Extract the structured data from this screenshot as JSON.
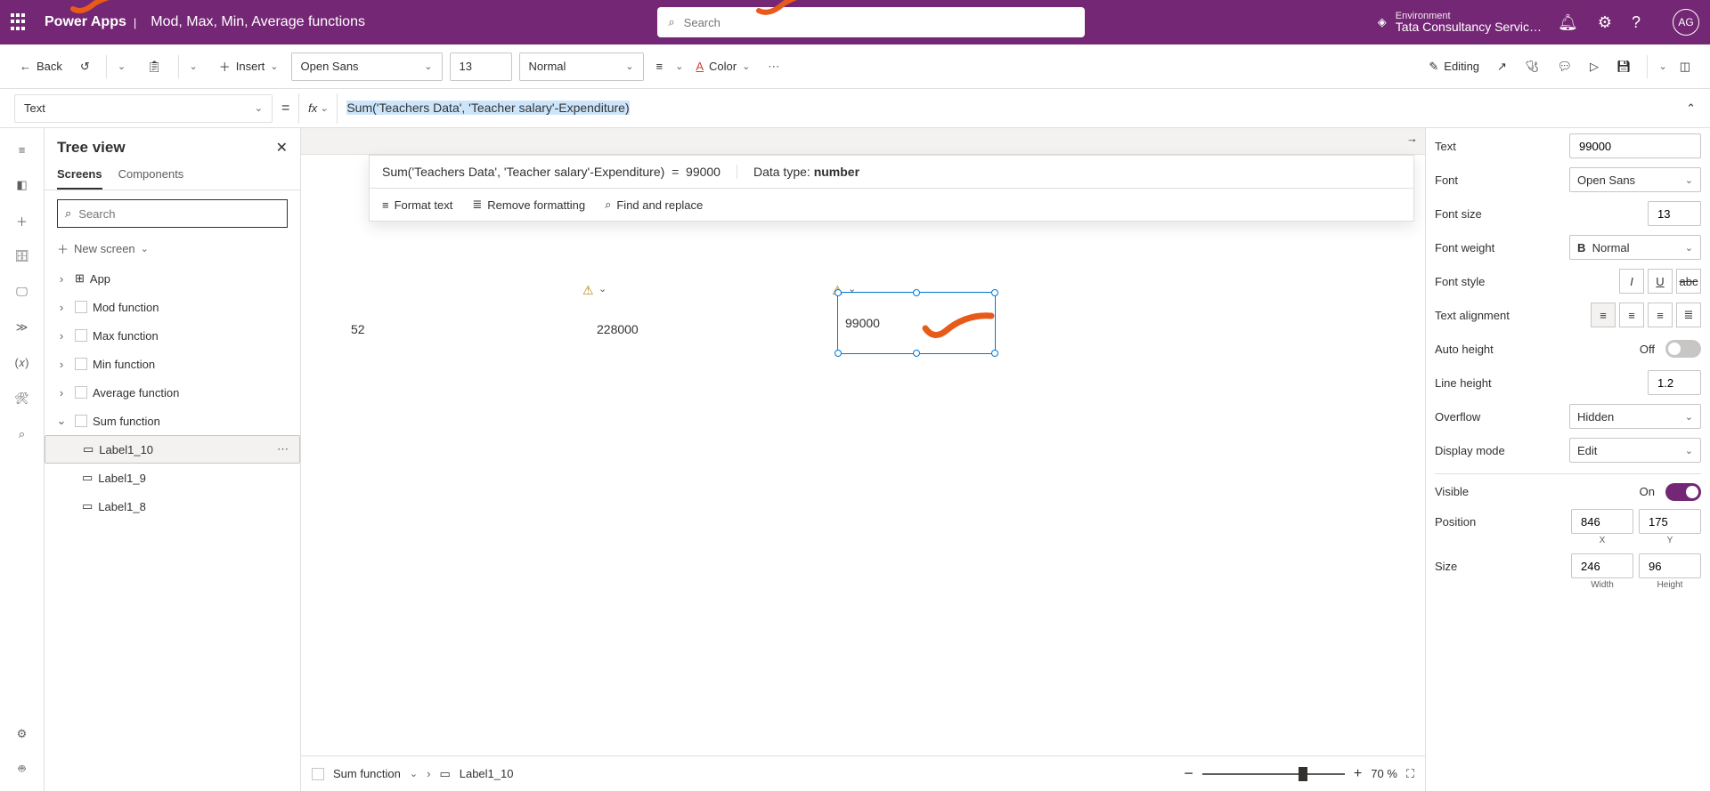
{
  "header": {
    "app_name": "Power Apps",
    "file_title": "Mod, Max, Min, Average functions",
    "search_placeholder": "Search",
    "env_label": "Environment",
    "env_name": "Tata Consultancy Servic…",
    "avatar": "AG"
  },
  "toolbar": {
    "back": "Back",
    "insert": "Insert",
    "font": "Open Sans",
    "font_size": "13",
    "font_weight": "Normal",
    "color": "Color",
    "editing": "Editing"
  },
  "formula": {
    "property": "Text",
    "text": "Sum('Teachers Data', 'Teacher salary'-Expenditure)",
    "eval_expr": "Sum('Teachers Data', 'Teacher salary'-Expenditure)",
    "eval_eq": "=",
    "eval_result": "99000",
    "datatype_label": "Data type:",
    "datatype": "number",
    "format_text": "Format text",
    "remove_formatting": "Remove formatting",
    "find_replace": "Find and replace"
  },
  "tree": {
    "title": "Tree view",
    "tab_screens": "Screens",
    "tab_components": "Components",
    "search_placeholder": "Search",
    "new_screen": "New screen",
    "nodes": [
      {
        "label": "App",
        "icon": "app"
      },
      {
        "label": "Mod function",
        "icon": "screen"
      },
      {
        "label": "Max function",
        "icon": "screen"
      },
      {
        "label": "Min function",
        "icon": "screen"
      },
      {
        "label": "Average function",
        "icon": "screen"
      },
      {
        "label": "Sum function",
        "icon": "screen",
        "expanded": true,
        "children": [
          {
            "label": "Label1_10",
            "selected": true
          },
          {
            "label": "Label1_9"
          },
          {
            "label": "Label1_8"
          }
        ]
      }
    ]
  },
  "canvas": {
    "val1": "52",
    "val2": "228000",
    "val3": "99000"
  },
  "breadcrumb": {
    "screen": "Sum function",
    "control": "Label1_10",
    "zoom_minus": "−",
    "zoom_plus": "+",
    "zoom": "70 %"
  },
  "props": {
    "text": {
      "label": "Text",
      "value": "99000"
    },
    "font": {
      "label": "Font",
      "value": "Open Sans"
    },
    "font_size": {
      "label": "Font size",
      "value": "13"
    },
    "font_weight": {
      "label": "Font weight",
      "value": "Normal"
    },
    "font_style": {
      "label": "Font style"
    },
    "text_align": {
      "label": "Text alignment"
    },
    "auto_height": {
      "label": "Auto height",
      "value": "Off"
    },
    "line_height": {
      "label": "Line height",
      "value": "1.2"
    },
    "overflow": {
      "label": "Overflow",
      "value": "Hidden"
    },
    "display_mode": {
      "label": "Display mode",
      "value": "Edit"
    },
    "visible": {
      "label": "Visible",
      "value": "On"
    },
    "position": {
      "label": "Position",
      "x": "846",
      "y": "175",
      "xl": "X",
      "yl": "Y"
    },
    "size": {
      "label": "Size",
      "w": "246",
      "h": "96",
      "wl": "Width",
      "hl": "Height"
    }
  }
}
